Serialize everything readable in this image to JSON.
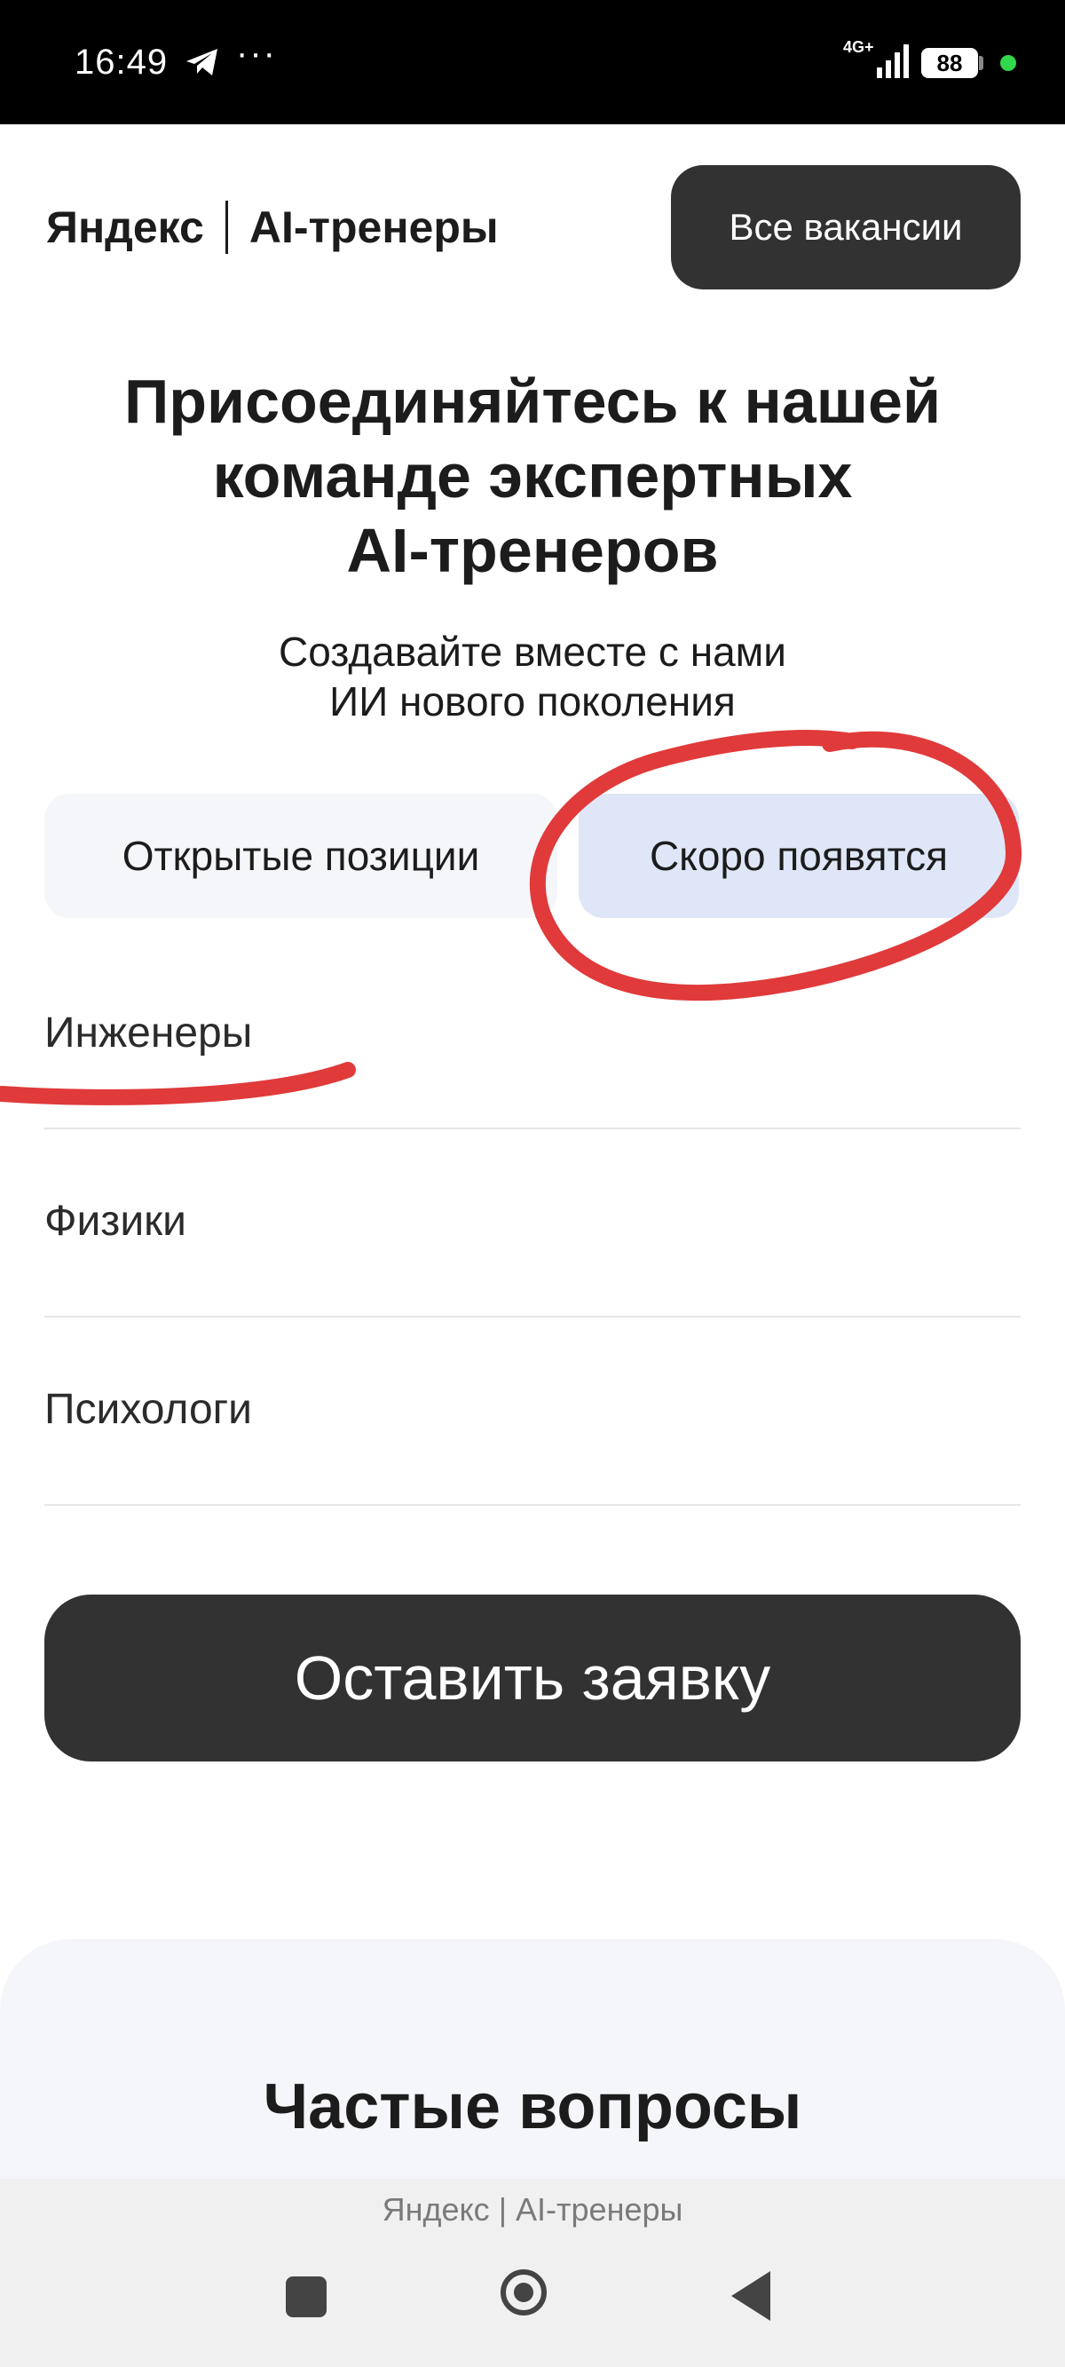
{
  "status_bar": {
    "time": "16:49",
    "telegram_icon": "telegram-icon",
    "more_dots": "···",
    "network": "4G+",
    "battery": "88"
  },
  "header": {
    "brand_yandex": "Яндекс",
    "brand_product": "AI-тренеры",
    "vacancies_button": "Все вакансии"
  },
  "hero": {
    "title_lines": [
      "Присоединяйтесь к нашей",
      "команде экспертных",
      "AI-тренеров"
    ],
    "subtitle_lines": [
      "Создавайте вместе с нами",
      "ИИ нового поколения"
    ]
  },
  "tabs": {
    "open": "Открытые позиции",
    "soon": "Скоро появятся",
    "selected": "soon"
  },
  "positions": [
    {
      "label": "Инженеры"
    },
    {
      "label": "Физики"
    },
    {
      "label": "Психологи"
    }
  ],
  "cta": {
    "label": "Оставить заявку"
  },
  "faq": {
    "title": "Частые вопросы"
  },
  "footer": {
    "site_title": "Яндекс | AI-тренеры"
  },
  "nav": {
    "recent_icon": "recent-apps-icon",
    "home_icon": "home-icon",
    "back_icon": "back-icon"
  },
  "annotations": {
    "color": "#e03a3a"
  }
}
